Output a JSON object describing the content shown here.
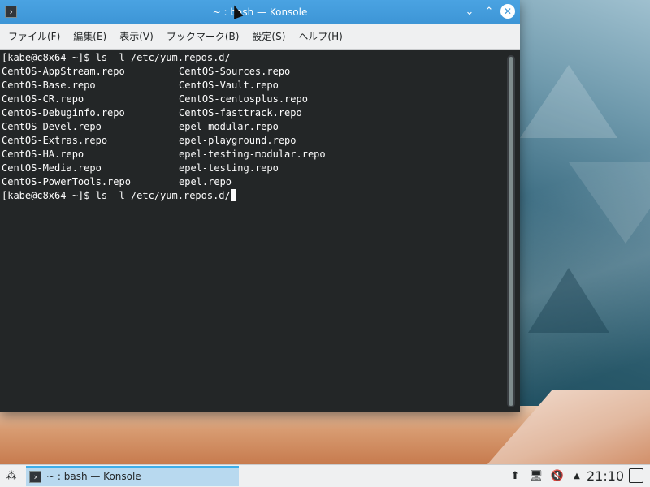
{
  "window": {
    "title": "~ : bash — Konsole",
    "app_icon_glyph": "›",
    "controls": {
      "minimize": "⌄",
      "maximize": "⌃",
      "close": "✕"
    }
  },
  "menubar": {
    "items": [
      "ファイル(F)",
      "編集(E)",
      "表示(V)",
      "ブックマーク(B)",
      "設定(S)",
      "ヘルプ(H)"
    ]
  },
  "terminal": {
    "prompt1": "[kabe@c8x64 ~]$ ls -l /etc/yum.repos.d/",
    "rows": [
      {
        "c1": "CentOS-AppStream.repo",
        "c2": "CentOS-Sources.repo"
      },
      {
        "c1": "CentOS-Base.repo",
        "c2": "CentOS-Vault.repo"
      },
      {
        "c1": "CentOS-CR.repo",
        "c2": "CentOS-centosplus.repo"
      },
      {
        "c1": "CentOS-Debuginfo.repo",
        "c2": "CentOS-fasttrack.repo"
      },
      {
        "c1": "CentOS-Devel.repo",
        "c2": "epel-modular.repo"
      },
      {
        "c1": "CentOS-Extras.repo",
        "c2": "epel-playground.repo"
      },
      {
        "c1": "CentOS-HA.repo",
        "c2": "epel-testing-modular.repo"
      },
      {
        "c1": "CentOS-Media.repo",
        "c2": "epel-testing.repo"
      },
      {
        "c1": "CentOS-PowerTools.repo",
        "c2": "epel.repo"
      }
    ],
    "prompt2": "[kabe@c8x64 ~]$ ls -l /etc/yum.repos.d/"
  },
  "panel": {
    "task_label": "~ : bash — Konsole",
    "clock": "21:10",
    "icons": [
      "launcher-icon",
      "updates-icon",
      "network-icon",
      "volume-muted-icon",
      "tray-expand-icon",
      "show-desktop-icon"
    ]
  },
  "colors": {
    "titlebar": "#3d95d6",
    "terminal_bg": "#232627",
    "terminal_fg": "#fcfcfc",
    "panel_bg": "#eff0f1",
    "task_active": "#b8d9ef"
  }
}
